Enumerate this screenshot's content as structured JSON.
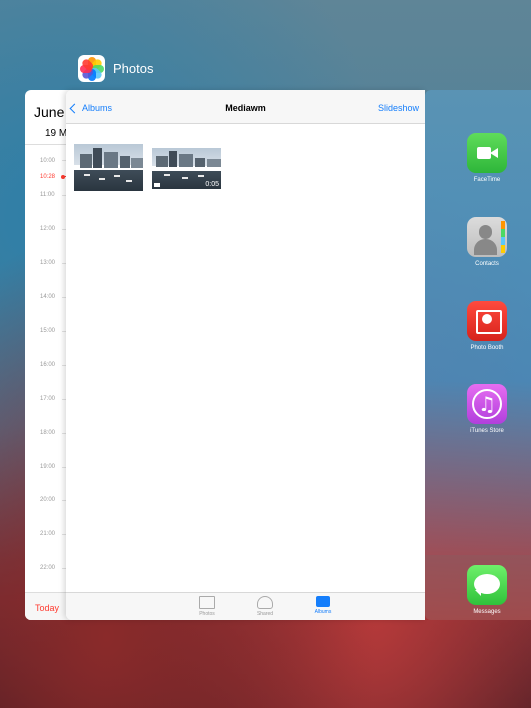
{
  "app_switcher": {
    "active_app_label": "Photos"
  },
  "calendar": {
    "month": "June",
    "day": "19 M",
    "hours": [
      "10:00",
      "11:00",
      "12:00",
      "13:00",
      "14:00",
      "15:00",
      "16:00",
      "17:00",
      "18:00",
      "19:00",
      "20:00",
      "21:00",
      "22:00"
    ],
    "now_time": "10:28",
    "today_label": "Today",
    "accent_color": "#ff3b30"
  },
  "photos": {
    "nav": {
      "back_label": "Albums",
      "title": "Mediawm",
      "action_label": "Slideshow"
    },
    "items": [
      {
        "type": "photo"
      },
      {
        "type": "video",
        "duration": "0:05"
      }
    ],
    "tabs": [
      {
        "label": "Photos",
        "icon": "photos-tab-icon",
        "active": false
      },
      {
        "label": "Shared",
        "icon": "cloud-icon",
        "active": false
      },
      {
        "label": "Albums",
        "icon": "albums-icon",
        "active": true
      }
    ],
    "accent_color": "#157efb"
  },
  "dock": {
    "items": [
      {
        "label": "FaceTime",
        "icon": "facetime-icon"
      },
      {
        "label": "Contacts",
        "icon": "contacts-icon"
      },
      {
        "label": "Photo Booth",
        "icon": "photo-booth-icon"
      },
      {
        "label": "iTunes Store",
        "icon": "itunes-store-icon"
      }
    ],
    "bottom_item": {
      "label": "Messages",
      "icon": "messages-icon"
    }
  }
}
